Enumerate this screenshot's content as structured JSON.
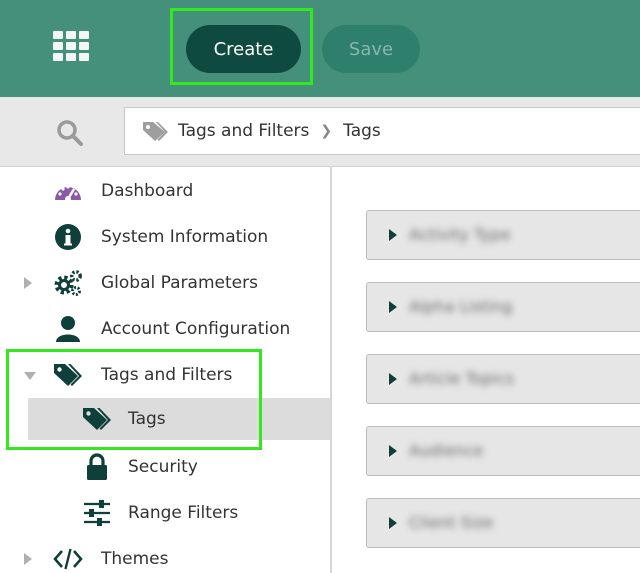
{
  "header": {
    "apps_icon": "apps-grid-icon",
    "create_label": "Create",
    "save_label": "Save",
    "colors": {
      "bar": "#45907a",
      "create_bg": "#0e4a40",
      "save_bg": "#2e7f6b",
      "highlight": "#33e81e"
    }
  },
  "breadcrumb": {
    "icon": "tag-icon",
    "items": [
      "Tags and Filters",
      "Tags"
    ]
  },
  "sidebar": {
    "items": [
      {
        "label": "Dashboard",
        "icon": "dashboard-gauge-icon"
      },
      {
        "label": "System Information",
        "icon": "info-icon"
      },
      {
        "label": "Global Parameters",
        "icon": "gears-icon"
      },
      {
        "label": "Account Configuration",
        "icon": "user-icon"
      },
      {
        "label": "Tags and Filters",
        "icon": "tags-icon"
      },
      {
        "label": "Tags",
        "icon": "tags-icon"
      },
      {
        "label": "Security",
        "icon": "lock-icon"
      },
      {
        "label": "Range Filters",
        "icon": "sliders-icon"
      },
      {
        "label": "Themes",
        "icon": "code-icon"
      }
    ]
  },
  "main": {
    "sections": [
      {
        "label": "Activity Type"
      },
      {
        "label": "Alpha Listing"
      },
      {
        "label": "Article Topics"
      },
      {
        "label": "Audience"
      },
      {
        "label": "Client Size"
      }
    ]
  }
}
